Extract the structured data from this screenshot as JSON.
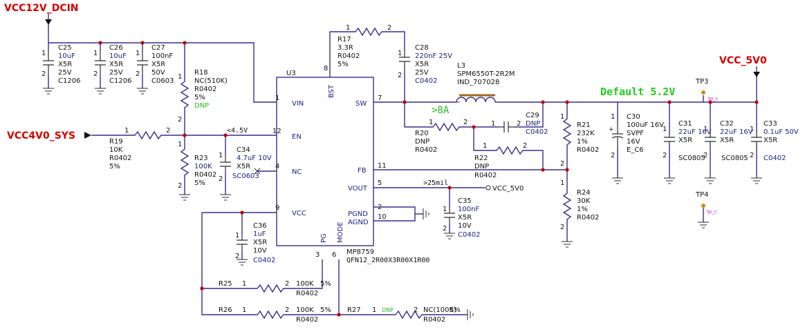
{
  "ports": {
    "vin": "VCC12V_DCIN",
    "sys": "VCC4V0_SYS",
    "vout": "VCC_5V0"
  },
  "default_note": "Default 5.2V",
  "current_note": ">8A",
  "net_45v": "<4.5V",
  "net_25mil": ">25mil",
  "vout_net": "VCC_5V0",
  "ic": {
    "ref": "U3",
    "part": "MP8759",
    "pkg": "QFN12_2R00X3R00X1R00",
    "pins": {
      "vin": "VIN",
      "en": "EN",
      "nc": "NC",
      "vcc": "VCC",
      "bst": "BST",
      "sw": "SW",
      "fb": "FB",
      "vout": "VOUT",
      "pgnd": "PGND",
      "agnd": "AGND",
      "pg": "PG",
      "mode": "MODE"
    },
    "pin_numbers": {
      "vin": "1",
      "en": "12",
      "nc": "4",
      "vcc": "9",
      "bst": "8",
      "sw": "7",
      "fb": "11",
      "vout": "5",
      "pgnd": "2",
      "agnd": "10",
      "pg": "3",
      "mode": "6"
    }
  },
  "caps": {
    "c25": [
      "C25",
      "10uF",
      "X5R",
      "25V",
      "C1206"
    ],
    "c26": [
      "C26",
      "10uF",
      "X5R",
      "25V",
      "C1206"
    ],
    "c27": [
      "C27",
      "100nF",
      "X5R",
      "50V",
      "C0603"
    ],
    "c34": [
      "C34",
      "4.7uF 10V",
      "X5R",
      "SC0603"
    ],
    "c36": [
      "C36",
      "1uF",
      "X5R",
      "10V",
      "C0402"
    ],
    "c28": [
      "C28",
      "220nF 25V",
      "X5R",
      "25V",
      "C0402"
    ],
    "c29": [
      "C29",
      "DNP",
      "C0402"
    ],
    "c35": [
      "C35",
      "100nF",
      "X5R",
      "10V",
      "C0402"
    ],
    "c30": [
      "C30",
      "100uF 16V",
      "SVPF",
      "16V",
      "E_C6"
    ],
    "c31": [
      "C31",
      "22uF 16V",
      "X5R",
      "SC0805"
    ],
    "c32": [
      "C32",
      "22uF 16V",
      "X5R",
      "SC0805"
    ],
    "c33": [
      "C33",
      "0.1uF 50V",
      "X5R",
      "C0402"
    ]
  },
  "res": {
    "r18": [
      "R18",
      "NC(510K)",
      "R0402",
      "5%",
      "DNP"
    ],
    "r19": [
      "R19",
      "10K",
      "R0402",
      "5%"
    ],
    "r23": [
      "R23",
      "100K",
      "R0402",
      "5%"
    ],
    "r17": [
      "R17",
      "3.3R",
      "R0402",
      "5%"
    ],
    "r20": [
      "R20",
      "DNP",
      "R0402"
    ],
    "r22": [
      "R22",
      "DNP",
      "R0402"
    ],
    "r21": [
      "R21",
      "232K",
      "1%",
      "R0402"
    ],
    "r24": [
      "R24",
      "30K",
      "1%",
      "R0402"
    ],
    "r25": [
      "R25",
      "100K",
      "5%",
      "R0402"
    ],
    "r26": [
      "R26",
      "100K",
      "5%",
      "R0402"
    ],
    "r27": [
      "R27",
      "DNP",
      "NC(100K)",
      "5%",
      "R0402"
    ]
  },
  "inductor": [
    "L3",
    "SPM6550T-2R2M",
    "IND_707028"
  ],
  "tp": {
    "tp3": "TP3",
    "tp4": "TP4",
    "tp_label": "tp_c"
  }
}
